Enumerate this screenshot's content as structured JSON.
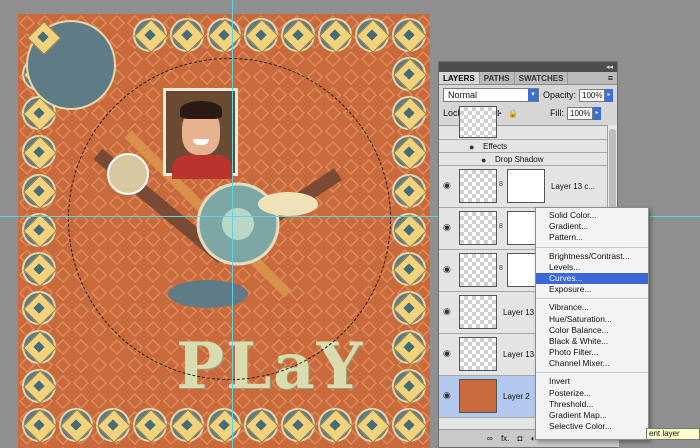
{
  "panel": {
    "tabs": [
      "LAYERS",
      "PATHS",
      "SWATCHES"
    ],
    "blend_mode": "Normal",
    "opacity_label": "Opacity:",
    "opacity_value": "100%",
    "lock_label": "Lock:",
    "fill_label": "Fill:",
    "fill_value": "100%",
    "effects_label": "Effects",
    "drop_shadow_label": "Drop Shadow",
    "layers": [
      {
        "name": "Layer 13 c...",
        "selected": false
      },
      {
        "name": "",
        "selected": false
      },
      {
        "name": "",
        "selected": false
      },
      {
        "name": "Layer 13",
        "selected": false
      },
      {
        "name": "Layer 13",
        "selected": false
      },
      {
        "name": "Layer 2",
        "selected": true
      }
    ],
    "footer_label": "fx."
  },
  "canvas": {
    "word": "PLaY"
  },
  "adjustment_menu": {
    "groups": [
      [
        "Solid Color...",
        "Gradient...",
        "Pattern..."
      ],
      [
        "Brightness/Contrast...",
        "Levels...",
        "Curves...",
        "Exposure..."
      ],
      [
        "Vibrance...",
        "Hue/Saturation...",
        "Color Balance...",
        "Black & White...",
        "Photo Filter...",
        "Channel Mixer..."
      ],
      [
        "Invert",
        "Posterize...",
        "Threshold...",
        "Gradient Map...",
        "Selective Color..."
      ]
    ],
    "highlighted": "Curves..."
  },
  "tooltip": "ent layer",
  "colors": {
    "canvas_bg": "#c96a3c",
    "highlight": "#3c67d6",
    "guide": "#5fd3e6",
    "selected_layer": "#b3c8ee"
  }
}
